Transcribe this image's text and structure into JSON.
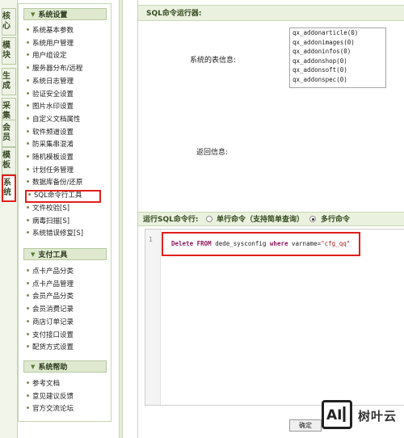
{
  "left_tabs": [
    {
      "label": "核心",
      "active": false
    },
    {
      "label": "模块",
      "active": false
    },
    {
      "label": "生成",
      "active": false
    },
    {
      "label": "采集",
      "active": false
    },
    {
      "label": "会员",
      "active": false
    },
    {
      "label": "模板",
      "active": false
    },
    {
      "label": "系统",
      "active": true
    }
  ],
  "menu": {
    "system_settings": {
      "title": "系统设置",
      "items": [
        "系统基本参数",
        "系统用户管理",
        "用户组设定",
        "服务器分布/远程",
        "系统日志管理",
        "验证安全设置",
        "图片水印设置",
        "自定义文档属性",
        "软件频道设置",
        "防采集串混淆",
        "随机模板设置",
        "计划任务管理",
        "数据库备份/还原",
        "SQL命令行工具",
        "文件校验[S]",
        "病毒扫描[S]",
        "系统错误修复[S]"
      ],
      "highlighted": "SQL命令行工具"
    },
    "payment_tools": {
      "title": "支付工具",
      "items": [
        "点卡产品分类",
        "点卡产品管理",
        "会员产品分类",
        "会员消费记录",
        "商店订单记录",
        "支付接口设置",
        "配货方式设置"
      ]
    },
    "system_help": {
      "title": "系统帮助",
      "items": [
        "参考文档",
        "意见建议反馈",
        "官方交流论坛"
      ]
    }
  },
  "panel": {
    "title": "SQL命令运行器:",
    "table_info_label": "系统的表信息:",
    "tables": [
      "qx_addonarticle(0)",
      "qx_addonimages(0)",
      "qx_addoninfos(0)",
      "qx_addonshop(0)",
      "qx_addonsoft(0)",
      "qx_addonspec(0)"
    ],
    "return_label": "返回信息:",
    "run_label": "运行SQL命令行:",
    "single_label": "单行命令（支持简单查询）",
    "multi_label": "多行命令",
    "mode": "multi",
    "line_number": "1",
    "code": {
      "kw1": "Delete",
      "kw2": "FROM",
      "table": "dede_sysconfig",
      "kw3": "where",
      "cond": "varname=",
      "value": "\"cfg_qq\""
    },
    "confirm_label": "确定"
  },
  "watermark": {
    "logo": "AI",
    "text": "树叶云"
  }
}
